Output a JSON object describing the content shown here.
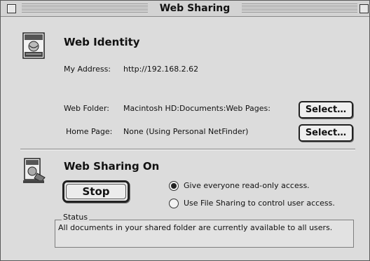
{
  "window": {
    "title": "Web Sharing"
  },
  "identity": {
    "heading": "Web Identity",
    "address_label": "My Address:",
    "address_value": "http://192.168.2.62"
  },
  "folder": {
    "folder_label": "Web Folder:",
    "folder_value": "Macintosh HD:Documents:Web Pages:",
    "home_label": "Home Page:",
    "home_value": "None (Using Personal NetFinder)",
    "select_label": "Select…",
    "select_label_2": "Select…"
  },
  "sharing": {
    "heading": "Web Sharing On",
    "stop_label": "Stop",
    "options": [
      {
        "label": "Give everyone read-only access.",
        "selected": true
      },
      {
        "label": "Use File Sharing to control user access.",
        "selected": false
      }
    ]
  },
  "status": {
    "legend": "Status",
    "text": "All documents in your shared folder are currently available to all users."
  },
  "icons": {
    "identity": "web-identity-icon",
    "sharing": "web-sharing-icon",
    "close": "close-box-icon",
    "zoom": "zoom-box-icon"
  }
}
